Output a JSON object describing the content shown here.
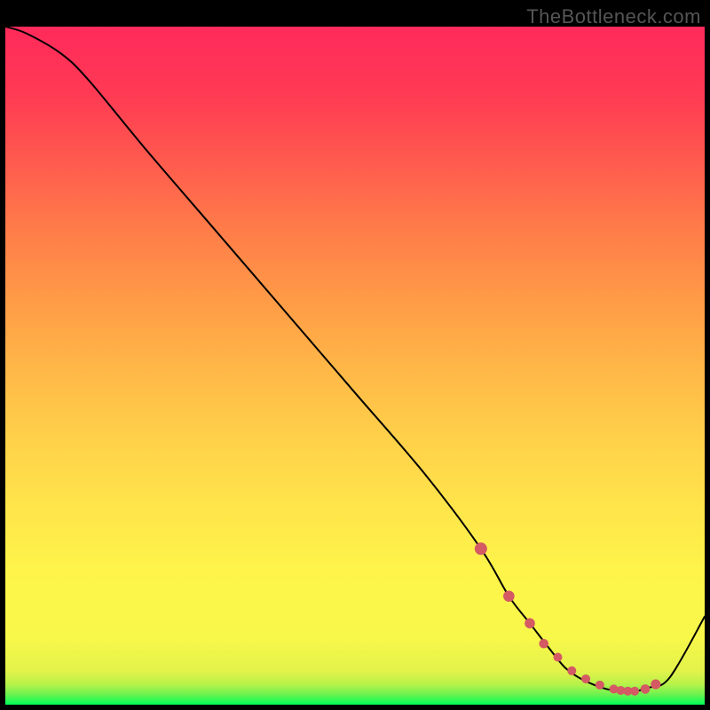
{
  "watermark": "TheBottleneck.com",
  "chart_data": {
    "type": "line",
    "title": "",
    "xlabel": "",
    "ylabel": "",
    "xlim": [
      0,
      100
    ],
    "ylim": [
      0,
      100
    ],
    "series": [
      {
        "name": "curve",
        "x": [
          0,
          3,
          8,
          12,
          20,
          30,
          40,
          50,
          60,
          68,
          72,
          75,
          78,
          80,
          82,
          84,
          86,
          88,
          90,
          92,
          95,
          100
        ],
        "y": [
          100,
          99,
          96,
          92,
          82,
          70,
          58,
          46,
          34,
          23,
          16,
          12,
          8,
          5.5,
          4,
          3,
          2.3,
          2,
          2,
          2.5,
          4,
          13
        ]
      }
    ],
    "markers": {
      "x": [
        68,
        72,
        75,
        77,
        79,
        81,
        83,
        85,
        87,
        88,
        89,
        90,
        91.5,
        93
      ],
      "y": [
        23,
        16,
        12,
        9,
        7,
        5,
        3.8,
        2.9,
        2.3,
        2.1,
        2,
        2,
        2.3,
        3
      ],
      "radii": [
        7,
        6.3,
        5.8,
        5.3,
        5,
        5,
        5,
        5,
        5,
        5,
        5,
        5,
        5.3,
        5.6
      ]
    }
  }
}
